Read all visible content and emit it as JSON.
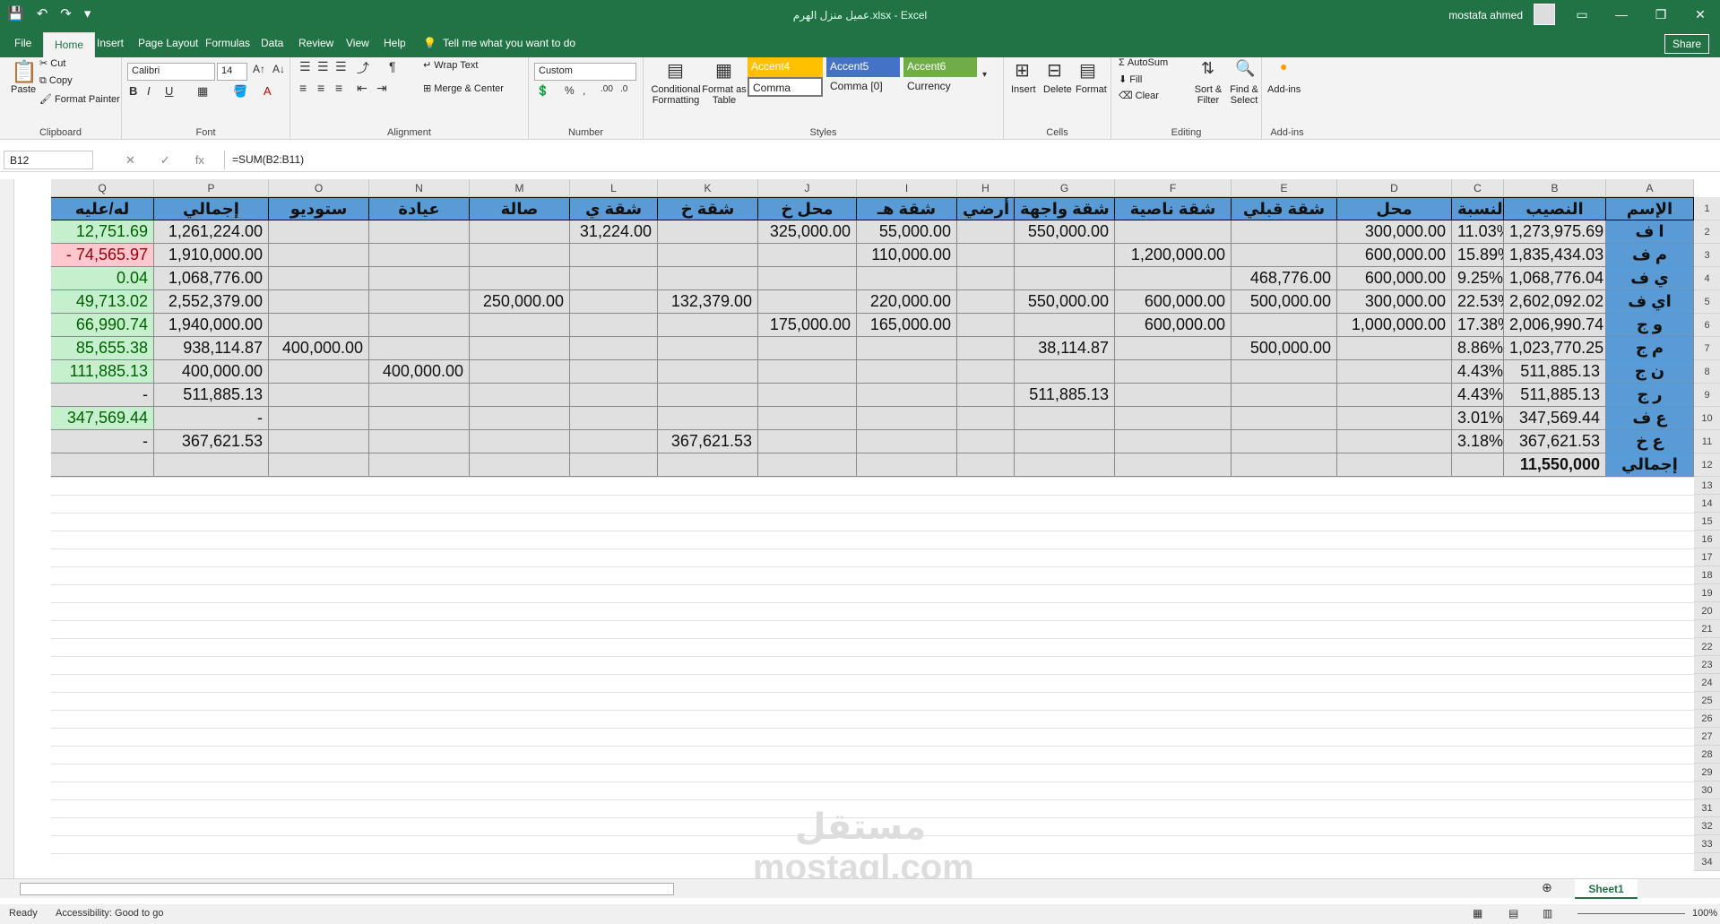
{
  "title": {
    "file": "عميل منزل الهرم.xlsx",
    "app": "Excel",
    "user": "mostafa ahmed"
  },
  "tabs": [
    "File",
    "Home",
    "Insert",
    "Page Layout",
    "Formulas",
    "Data",
    "Review",
    "View",
    "Help"
  ],
  "tell_me": "Tell me what you want to do",
  "share": "Share",
  "ribbon": {
    "clipboard": {
      "paste": "Paste",
      "cut": "Cut",
      "copy": "Copy",
      "format_painter": "Format Painter",
      "label": "Clipboard"
    },
    "font": {
      "name": "Calibri",
      "size": "14",
      "label": "Font"
    },
    "alignment": {
      "wrap": "Wrap Text",
      "merge": "Merge & Center",
      "label": "Alignment"
    },
    "number": {
      "format": "Custom",
      "label": "Number"
    },
    "styles": {
      "conditional": "Conditional Formatting",
      "format_table": "Format as Table",
      "accent4": "Accent4",
      "accent5": "Accent5",
      "accent6": "Accent6",
      "comma": "Comma",
      "comma0": "Comma [0]",
      "currency": "Currency",
      "label": "Styles"
    },
    "cells": {
      "insert": "Insert",
      "delete": "Delete",
      "format": "Format",
      "label": "Cells"
    },
    "editing": {
      "autosum": "AutoSum",
      "fill": "Fill",
      "clear": "Clear",
      "sort": "Sort & Filter",
      "find": "Find & Select",
      "label": "Editing"
    },
    "addins": {
      "addins": "Add-ins",
      "label": "Add-ins"
    }
  },
  "formula_bar": {
    "cell": "B12",
    "fx": "fx",
    "formula": "=SUM(B2:B11)"
  },
  "columns": [
    "A",
    "B",
    "C",
    "D",
    "E",
    "F",
    "G",
    "H",
    "I",
    "J",
    "K",
    "L",
    "M",
    "N",
    "O",
    "P",
    "Q"
  ],
  "header_row": [
    "الإسم",
    "النصيب",
    "النسبة",
    "محل",
    "شقة قبلي",
    "شقة ناصية",
    "شقة واجهة",
    "أرضي",
    "شقة هـ",
    "محل خ",
    "شقة خ",
    "شقة ي",
    "صالة",
    "عيادة",
    "ستوديو",
    "إجمالي",
    "له/عليه"
  ],
  "rows": [
    [
      "ا ف",
      "1,273,975.69",
      "11.03%",
      "300,000.00",
      "",
      "",
      "550,000.00",
      "",
      "55,000.00",
      "325,000.00",
      "",
      "31,224.00",
      "",
      "",
      "",
      "1,261,224.00",
      "12,751.69"
    ],
    [
      "م ف",
      "1,835,434.03",
      "15.89%",
      "600,000.00",
      "",
      "1,200,000.00",
      "",
      "",
      "110,000.00",
      "",
      "",
      "",
      "",
      "",
      "",
      "1,910,000.00",
      "- 74,565.97"
    ],
    [
      "ي ف",
      "1,068,776.04",
      "9.25%",
      "600,000.00",
      "468,776.00",
      "",
      "",
      "",
      "",
      "",
      "",
      "",
      "",
      "",
      "",
      "1,068,776.00",
      "0.04"
    ],
    [
      "اي ف",
      "2,602,092.02",
      "22.53%",
      "300,000.00",
      "500,000.00",
      "600,000.00",
      "550,000.00",
      "",
      "220,000.00",
      "",
      "132,379.00",
      "",
      "250,000.00",
      "",
      "",
      "2,552,379.00",
      "49,713.02"
    ],
    [
      "و ج",
      "2,006,990.74",
      "17.38%",
      "1,000,000.00",
      "",
      "600,000.00",
      "",
      "",
      "165,000.00",
      "175,000.00",
      "",
      "",
      "",
      "",
      "",
      "1,940,000.00",
      "66,990.74"
    ],
    [
      "م ج",
      "1,023,770.25",
      "8.86%",
      "",
      "500,000.00",
      "",
      "38,114.87",
      "",
      "",
      "",
      "",
      "",
      "",
      "",
      "400,000.00",
      "938,114.87",
      "85,655.38"
    ],
    [
      "ن ج",
      "511,885.13",
      "4.43%",
      "",
      "",
      "",
      "",
      "",
      "",
      "",
      "",
      "",
      "",
      "400,000.00",
      "",
      "400,000.00",
      "111,885.13"
    ],
    [
      "ر ج",
      "511,885.13",
      "4.43%",
      "",
      "",
      "",
      "511,885.13",
      "",
      "",
      "",
      "",
      "",
      "",
      "",
      "",
      "511,885.13",
      "-"
    ],
    [
      "ع ف",
      "347,569.44",
      "3.01%",
      "",
      "",
      "",
      "",
      "",
      "",
      "",
      "",
      "",
      "",
      "",
      "",
      "-",
      "347,569.44"
    ],
    [
      "ع خ",
      "367,621.53",
      "3.18%",
      "",
      "",
      "",
      "",
      "",
      "",
      "",
      "367,621.53",
      "",
      "",
      "",
      "",
      "367,621.53",
      "-"
    ],
    [
      "إجمالي",
      "11,550,000",
      "",
      "",
      "",
      "",
      "",
      "",
      "",
      "",
      "",
      "",
      "",
      "",
      "",
      "",
      ""
    ]
  ],
  "row_numbers": [
    "1",
    "2",
    "3",
    "4",
    "5",
    "6",
    "7",
    "8",
    "9",
    "10",
    "11",
    "12",
    "13",
    "14",
    "15",
    "16",
    "17",
    "18",
    "19",
    "20",
    "21",
    "22",
    "23",
    "24",
    "25",
    "26",
    "27",
    "28",
    "29",
    "30",
    "31",
    "32",
    "33",
    "34"
  ],
  "sheet": "Sheet1",
  "status": {
    "ready": "Ready",
    "accessibility": "Accessibility: Good to go",
    "zoom": "100%"
  },
  "watermark": "مستقل mostaql.com",
  "colors": {
    "green": "#217346",
    "header": "#5b9bd5",
    "positive": "#c6efce",
    "negative": "#ffc7ce"
  }
}
